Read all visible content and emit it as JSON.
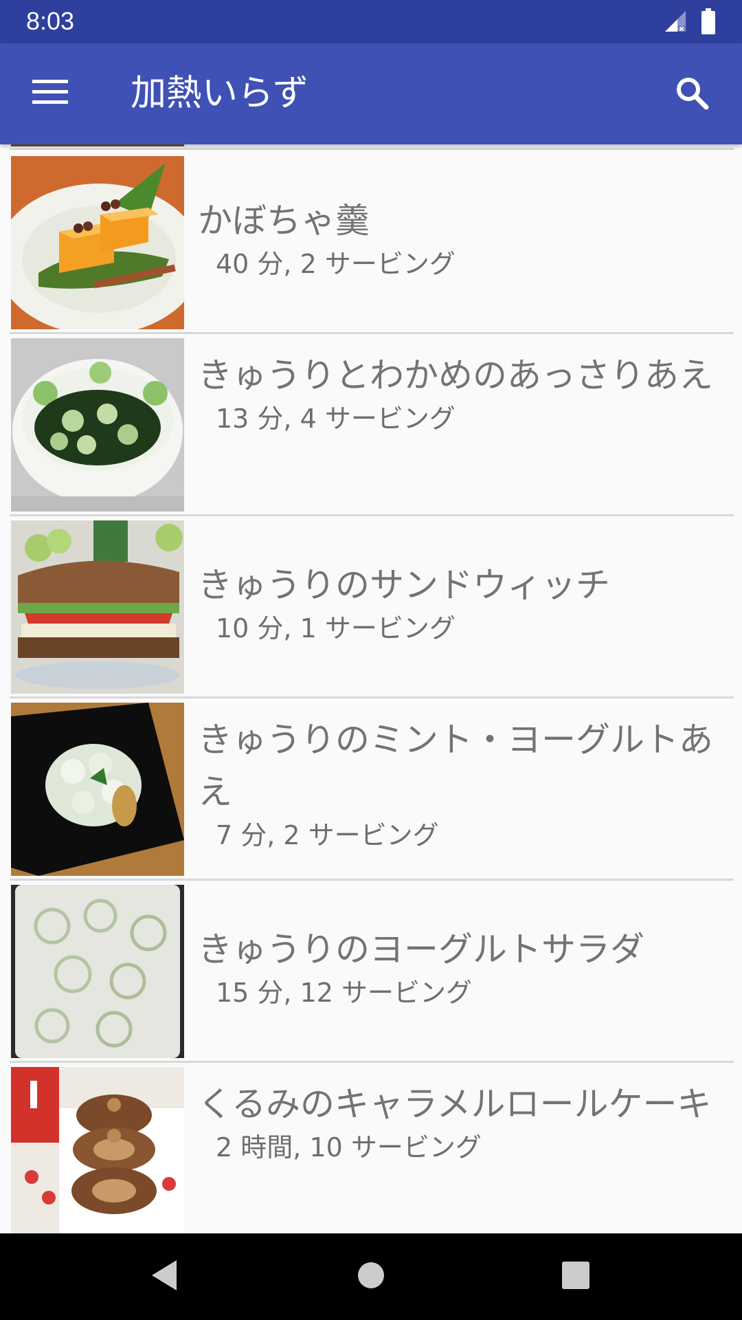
{
  "status_bar": {
    "time": "8:03"
  },
  "app_bar": {
    "title": "加熱いらず"
  },
  "recipes": [
    {
      "title": "かぼちゃ羹",
      "meta": "40 分, 2 サービング"
    },
    {
      "title": "きゅうりとわかめのあっさりあえ",
      "meta": "13 分, 4 サービング"
    },
    {
      "title": "きゅうりのサンドウィッチ",
      "meta": "10 分, 1 サービング"
    },
    {
      "title": "きゅうりのミント・ヨーグルトあえ",
      "meta": "7 分, 2 サービング"
    },
    {
      "title": "きゅうりのヨーグルトサラダ",
      "meta": "15 分, 12 サービング"
    },
    {
      "title": "くるみのキャラメルロールケーキ",
      "meta": "2 時間, 10 サービング"
    }
  ],
  "icons": {
    "menu": "menu-icon",
    "search": "search-icon",
    "signal": "signal-icon",
    "battery": "battery-icon",
    "back": "back-icon",
    "home": "home-icon",
    "recents": "recents-icon"
  },
  "colors": {
    "status_bar": "#2f3f9e",
    "app_bar": "#3f51b5",
    "background": "#fafafa",
    "divider": "#d8d8d8",
    "text": "#737373"
  }
}
